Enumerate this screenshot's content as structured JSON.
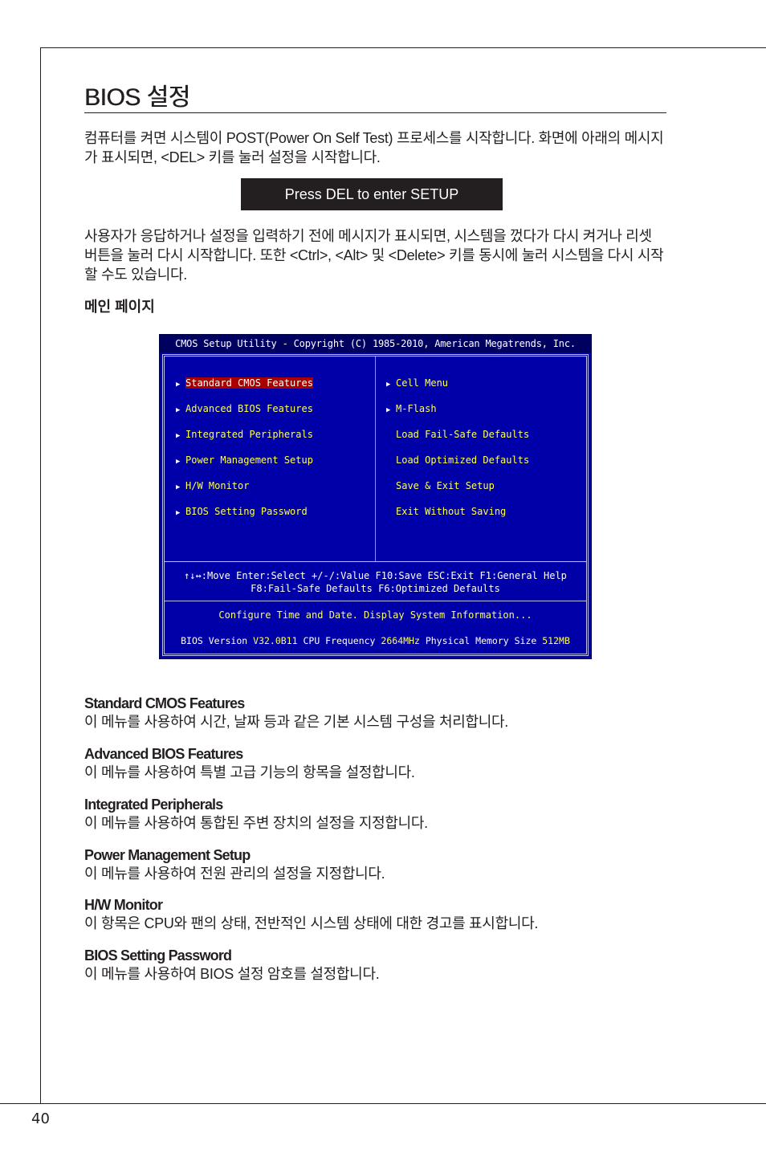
{
  "page": {
    "title": "BIOS 설정",
    "page_number": "40"
  },
  "intro": {
    "paragraph1": "컴퓨터를 켜면 시스템이 POST(Power On Self Test) 프로세스를 시작합니다. 화면에 아래의 메시지가 표시되면, <DEL> 키를 눌러 설정을 시작합니다.",
    "press_message": "Press DEL to enter SETUP",
    "paragraph2": "사용자가 응답하거나 설정을 입력하기 전에 메시지가 표시되면, 시스템을 껐다가 다시 켜거나 리셋 버튼을 눌러 다시 시작합니다. 또한 <Ctrl>, <Alt> 및 <Delete> 키를 동시에 눌러 시스템을 다시 시작할 수도 있습니다.",
    "subheading": "메인 페이지"
  },
  "bios": {
    "header": "CMOS Setup Utility - Copyright (C) 1985-2010, American Megatrends, Inc.",
    "left_menu": [
      {
        "label": "Standard CMOS Features",
        "arrow": "▶",
        "selected": true
      },
      {
        "label": "Advanced BIOS Features",
        "arrow": "▶",
        "selected": false
      },
      {
        "label": "Integrated Peripherals",
        "arrow": "▶",
        "selected": false
      },
      {
        "label": "Power Management Setup",
        "arrow": "▶",
        "selected": false
      },
      {
        "label": "H/W Monitor",
        "arrow": "▶",
        "selected": false
      },
      {
        "label": "BIOS Setting Password",
        "arrow": "▶",
        "selected": false
      }
    ],
    "right_menu": [
      {
        "label": "Cell Menu",
        "arrow": "▶"
      },
      {
        "label": "M-Flash",
        "arrow": "▶"
      },
      {
        "label": "Load Fail-Safe Defaults",
        "arrow": ""
      },
      {
        "label": "Load Optimized Defaults",
        "arrow": ""
      },
      {
        "label": "Save & Exit Setup",
        "arrow": ""
      },
      {
        "label": "Exit Without Saving",
        "arrow": ""
      }
    ],
    "help_line1": "↑↓↔:Move  Enter:Select  +/-/:Value  F10:Save  ESC:Exit  F1:General Help",
    "help_line2": "F8:Fail-Safe Defaults   F6:Optimized Defaults",
    "description": "Configure Time and Date.  Display System Information...",
    "info": {
      "bios_version_label": "BIOS Version",
      "bios_version": "V32.0B11",
      "cpu_freq_label": "CPU Frequency",
      "cpu_freq": "2664MHz",
      "memory_label": "Physical Memory Size",
      "memory": "512MB"
    },
    "colors": {
      "background": "#0000a8",
      "text": "#ffff55",
      "highlight": "#a80000"
    }
  },
  "sections": [
    {
      "title": "Standard CMOS Features",
      "desc": "이 메뉴를 사용하여 시간, 날짜 등과 같은 기본 시스템 구성을 처리합니다."
    },
    {
      "title": "Advanced BIOS Features",
      "desc": "이 메뉴를 사용하여 특별 고급 기능의 항목을 설정합니다."
    },
    {
      "title": "Integrated Peripherals",
      "desc": "이 메뉴를 사용하여 통합된 주변 장치의 설정을 지정합니다."
    },
    {
      "title": "Power Management Setup",
      "desc": "이 메뉴를 사용하여 전원 관리의 설정을 지정합니다."
    },
    {
      "title": "H/W Monitor",
      "desc": "이 항목은 CPU와 팬의 상태, 전반적인 시스템 상태에 대한 경고를 표시합니다."
    },
    {
      "title": "BIOS Setting Password",
      "desc": "이 메뉴를 사용하여 BIOS 설정 암호를 설정합니다."
    }
  ]
}
